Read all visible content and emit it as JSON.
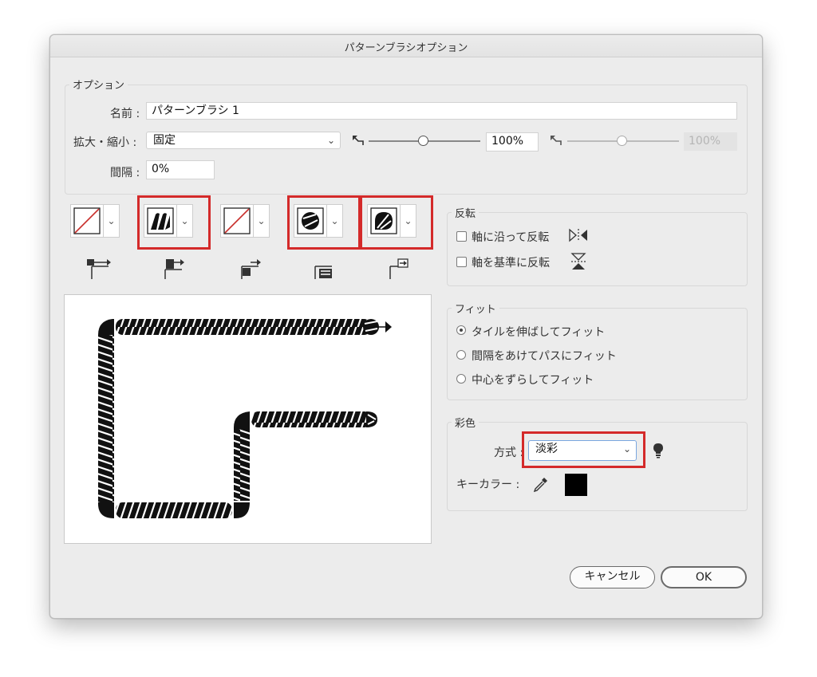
{
  "dialog": {
    "title": "パターンブラシオプション"
  },
  "options": {
    "group_label": "オプション",
    "name_label": "名前 :",
    "name_value": "パターンブラシ 1",
    "scale_label": "拡大・縮小 :",
    "scale_mode": "固定",
    "scale_value": "100%",
    "scale_value_disabled": "100%",
    "spacing_label": "間隔 :",
    "spacing_value": "0%"
  },
  "tiles": {
    "items": [
      {
        "name": "side-tile",
        "icon": "none-swatch-icon",
        "highlighted": false
      },
      {
        "name": "outer-corner-tile",
        "icon": "rope-pattern-icon",
        "highlighted": true
      },
      {
        "name": "inner-corner-tile",
        "icon": "none-swatch-icon",
        "highlighted": false
      },
      {
        "name": "start-tile",
        "icon": "rope-end-round-icon",
        "highlighted": true
      },
      {
        "name": "end-tile",
        "icon": "rope-end-leaf-icon",
        "highlighted": true
      }
    ],
    "dropdown_glyph": "⌄"
  },
  "flip": {
    "group_label": "反転",
    "along_label": "軸に沿って反転",
    "across_label": "軸を基準に反転",
    "along_checked": false,
    "across_checked": false
  },
  "fit": {
    "group_label": "フィット",
    "options": [
      "タイルを伸ばしてフィット",
      "間隔をあけてパスにフィット",
      "中心をずらしてフィット"
    ],
    "selected_index": 0
  },
  "colorization": {
    "group_label": "彩色",
    "method_label": "方式 :",
    "method_value": "淡彩",
    "key_color_label": "キーカラー :",
    "key_color": "#000000"
  },
  "buttons": {
    "cancel": "キャンセル",
    "ok": "OK"
  },
  "colors": {
    "highlight": "#d42a2a",
    "dialog_bg": "#ececec",
    "slider_track": "#888888"
  }
}
